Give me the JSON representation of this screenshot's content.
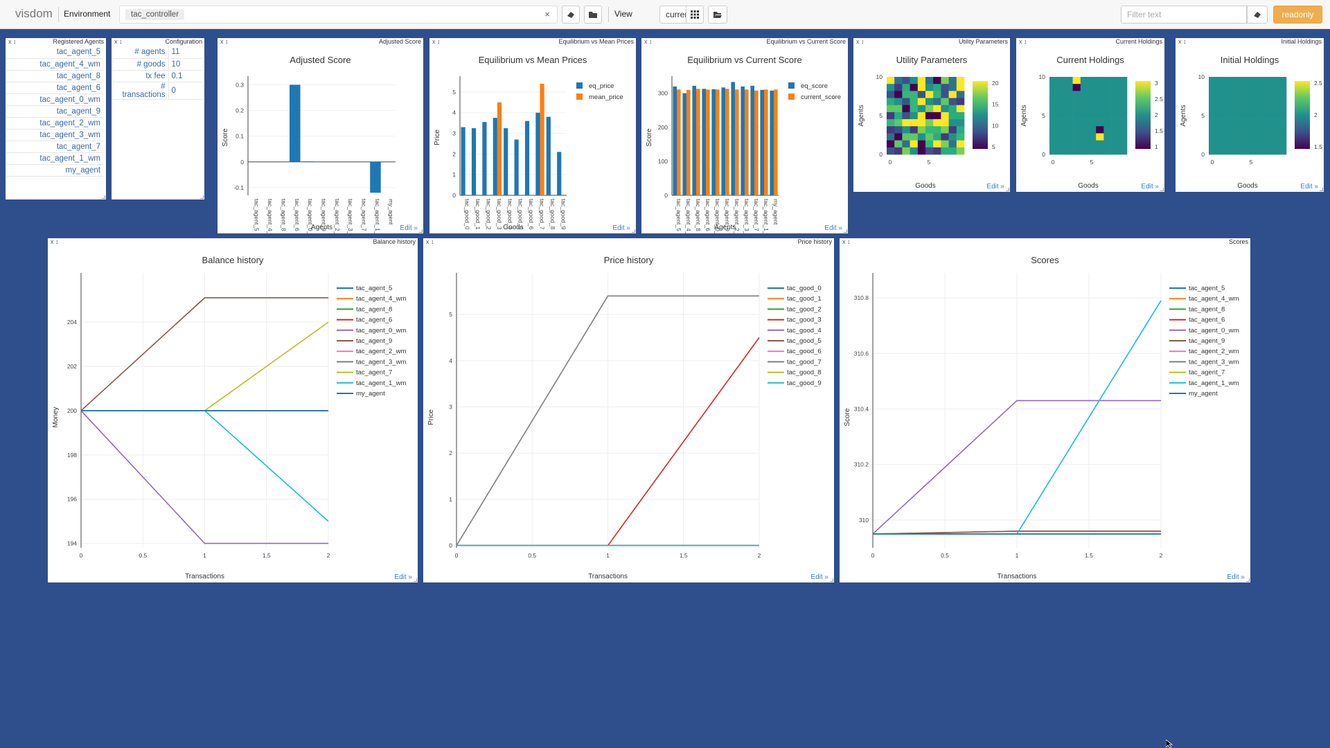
{
  "topbar": {
    "brand": "visdom",
    "env_label": "Environment",
    "env_value": "tac_controller",
    "env_clear": "×",
    "view_label": "View",
    "view_value": "current",
    "filter_placeholder": "Filter text",
    "readonly": "readonly"
  },
  "panes": {
    "agents": {
      "title": "Registered Agents",
      "items": [
        "tac_agent_5",
        "tac_agent_4_wm",
        "tac_agent_8",
        "tac_agent_6",
        "tac_agent_0_wm",
        "tac_agent_9",
        "tac_agent_2_wm",
        "tac_agent_3_wm",
        "tac_agent_7",
        "tac_agent_1_wm",
        "my_agent"
      ]
    },
    "config": {
      "title": "Configuration",
      "rows": [
        {
          "k": "# agents",
          "v": "11"
        },
        {
          "k": "# goods",
          "v": "10"
        },
        {
          "k": "tx fee",
          "v": "0.1"
        },
        {
          "k": "# transactions",
          "v": "0"
        }
      ]
    },
    "edit_label": "Edit »",
    "pane_controls": "x  ↕"
  },
  "chart_data": [
    {
      "id": "adjusted",
      "type": "bar",
      "title": "Adjusted Score",
      "xlabel": "Agents",
      "ylabel": "Score",
      "categories": [
        "tac_agent_5",
        "tac_agent_4_wm",
        "tac_agent_8",
        "tac_agent_6",
        "tac_agent_0_wm",
        "tac_agent_9",
        "tac_agent_2_wm",
        "tac_agent_3_wm",
        "tac_agent_7",
        "tac_agent_1_wm",
        "my_agent"
      ],
      "ticks": [
        0.3,
        0.2,
        0.1,
        0,
        -0.1
      ],
      "ylim": [
        -0.13,
        0.32
      ],
      "values": [
        0,
        0,
        0,
        0.3,
        0.002,
        0,
        0,
        0,
        0,
        -0.12,
        0
      ]
    },
    {
      "id": "eqmean",
      "type": "bar",
      "title": "Equilibrium vs Mean Prices",
      "xlabel": "Goods",
      "ylabel": "Price",
      "categories": [
        "tac_good_0",
        "tac_good_1",
        "tac_good_2",
        "tac_good_3",
        "tac_good_4",
        "tac_good_5",
        "tac_good_6",
        "tac_good_7",
        "tac_good_8",
        "tac_good_9"
      ],
      "ticks": [
        5,
        4,
        3,
        2,
        1,
        0
      ],
      "ylim": [
        0,
        5.6
      ],
      "series": [
        {
          "name": "eq_price",
          "color": "#1f77b4",
          "values": [
            3.3,
            3.25,
            3.55,
            3.75,
            3.25,
            2.7,
            3.6,
            4.0,
            3.8,
            2.1
          ]
        },
        {
          "name": "mean_price",
          "color": "#ff7f0e",
          "values": [
            0,
            0,
            0,
            4.5,
            0,
            0,
            0,
            5.4,
            0,
            0
          ]
        }
      ]
    },
    {
      "id": "eqcur",
      "type": "bar",
      "title": "Equilibrium vs Current Score",
      "xlabel": "Agents",
      "ylabel": "Score",
      "categories": [
        "tac_agent_5",
        "tac_agent_4_wm",
        "tac_agent_8",
        "tac_agent_6",
        "tac_agent_0_wm",
        "tac_agent_9",
        "tac_agent_2_wm",
        "tac_agent_3_wm",
        "tac_agent_7",
        "tac_agent_1_wm",
        "my_agent"
      ],
      "ticks": [
        300,
        200,
        100,
        0
      ],
      "ylim": [
        0,
        340
      ],
      "series": [
        {
          "name": "eq_score",
          "color": "#1f77b4",
          "values": [
            320,
            300,
            322,
            313,
            312,
            317,
            333,
            320,
            322,
            310,
            308
          ]
        },
        {
          "name": "current_score",
          "color": "#ff7f0e",
          "values": [
            311,
            310,
            313,
            311,
            311,
            313,
            311,
            311,
            308,
            311,
            311
          ]
        }
      ]
    },
    {
      "id": "utility",
      "type": "heatmap",
      "title": "Utility Parameters",
      "xlabel": "Goods",
      "ylabel": "Agents",
      "yticks": [
        10,
        5,
        0
      ],
      "xticks": [
        0,
        5
      ],
      "cbticks": [
        20,
        15,
        10,
        5
      ]
    },
    {
      "id": "current",
      "type": "heatmap",
      "title": "Current Holdings",
      "xlabel": "Goods",
      "ylabel": "Agents",
      "yticks": [
        10,
        5,
        0
      ],
      "xticks": [
        0,
        5
      ],
      "cbticks": [
        3,
        2.5,
        2,
        1.5,
        1
      ]
    },
    {
      "id": "initial",
      "type": "heatmap",
      "title": "Initial Holdings",
      "xlabel": "Goods",
      "ylabel": "Agents",
      "yticks": [
        10,
        5,
        0
      ],
      "xticks": [
        0,
        5
      ],
      "cbticks": [
        2.5,
        2,
        1.5
      ]
    },
    {
      "id": "balance",
      "type": "line",
      "title": "Balance history",
      "xlabel": "Transactions",
      "ylabel": "Money",
      "x": [
        0,
        1,
        2
      ],
      "xticks": [
        0,
        0.5,
        1,
        1.5,
        2
      ],
      "yticks": [
        204,
        202,
        200,
        198,
        196,
        194
      ],
      "ylim": [
        193.8,
        205.6
      ],
      "series": [
        {
          "name": "tac_agent_5",
          "color": "#1f77b4",
          "values": [
            200,
            200,
            200
          ]
        },
        {
          "name": "tac_agent_4_wm",
          "color": "#ff7f0e",
          "values": [
            200,
            200,
            200
          ]
        },
        {
          "name": "tac_agent_8",
          "color": "#2ca02c",
          "values": [
            200,
            200,
            200
          ]
        },
        {
          "name": "tac_agent_6",
          "color": "#d62728",
          "values": [
            200,
            200,
            200
          ]
        },
        {
          "name": "tac_agent_0_wm",
          "color": "#9467bd",
          "values": [
            200,
            194,
            194
          ]
        },
        {
          "name": "tac_agent_9",
          "color": "#8c564b",
          "values": [
            200,
            205.1,
            205.1
          ]
        },
        {
          "name": "tac_agent_2_wm",
          "color": "#e377c2",
          "values": [
            200,
            200,
            200
          ]
        },
        {
          "name": "tac_agent_3_wm",
          "color": "#7f7f7f",
          "values": [
            200,
            200,
            200
          ]
        },
        {
          "name": "tac_agent_7",
          "color": "#bcbd22",
          "values": [
            200,
            200,
            204
          ]
        },
        {
          "name": "tac_agent_1_wm",
          "color": "#17becf",
          "values": [
            200,
            200,
            195
          ]
        },
        {
          "name": "my_agent",
          "color": "#1f77b4",
          "values": [
            200,
            200,
            200
          ]
        }
      ]
    },
    {
      "id": "price",
      "type": "line",
      "title": "Price history",
      "xlabel": "Transactions",
      "ylabel": "Price",
      "x": [
        0,
        1,
        2
      ],
      "xticks": [
        0,
        0.5,
        1,
        1.5,
        2
      ],
      "yticks": [
        5,
        4,
        3,
        2,
        1,
        0
      ],
      "ylim": [
        -0.05,
        5.6
      ],
      "series": [
        {
          "name": "tac_good_0",
          "color": "#1f77b4",
          "values": [
            0,
            0,
            0
          ]
        },
        {
          "name": "tac_good_1",
          "color": "#ff7f0e",
          "values": [
            0,
            0,
            0
          ]
        },
        {
          "name": "tac_good_2",
          "color": "#2ca02c",
          "values": [
            0,
            0,
            0
          ]
        },
        {
          "name": "tac_good_3",
          "color": "#d62728",
          "values": [
            0,
            0,
            4.5
          ]
        },
        {
          "name": "tac_good_4",
          "color": "#9467bd",
          "values": [
            0,
            0,
            0
          ]
        },
        {
          "name": "tac_good_5",
          "color": "#8c564b",
          "values": [
            0,
            0,
            0
          ]
        },
        {
          "name": "tac_good_6",
          "color": "#e377c2",
          "values": [
            0,
            0,
            0
          ]
        },
        {
          "name": "tac_good_7",
          "color": "#7f7f7f",
          "values": [
            0,
            5.4,
            5.4
          ]
        },
        {
          "name": "tac_good_8",
          "color": "#bcbd22",
          "values": [
            0,
            0,
            0
          ]
        },
        {
          "name": "tac_good_9",
          "color": "#17becf",
          "values": [
            0,
            0,
            0
          ]
        }
      ]
    },
    {
      "id": "scores",
      "type": "line",
      "title": "Scores",
      "xlabel": "Transactions",
      "ylabel": "Score",
      "x": [
        0,
        1,
        2
      ],
      "xticks": [
        0,
        0.5,
        1,
        1.5,
        2
      ],
      "yticks": [
        310.8,
        310.6,
        310.4,
        310.2,
        310
      ],
      "ylim": [
        309.9,
        310.84
      ],
      "series": [
        {
          "name": "tac_agent_5",
          "color": "#1f77b4",
          "values": [
            309.95,
            309.95,
            309.95
          ]
        },
        {
          "name": "tac_agent_4_wm",
          "color": "#ff7f0e",
          "values": [
            309.95,
            309.96,
            309.96
          ]
        },
        {
          "name": "tac_agent_8",
          "color": "#2ca02c",
          "values": [
            309.95,
            309.95,
            309.95
          ]
        },
        {
          "name": "tac_agent_6",
          "color": "#d62728",
          "values": [
            309.95,
            309.95,
            309.95
          ]
        },
        {
          "name": "tac_agent_0_wm",
          "color": "#9467bd",
          "values": [
            309.95,
            310.43,
            310.43
          ]
        },
        {
          "name": "tac_agent_9",
          "color": "#8c564b",
          "values": [
            309.95,
            309.96,
            309.96
          ]
        },
        {
          "name": "tac_agent_2_wm",
          "color": "#e377c2",
          "values": [
            309.95,
            309.95,
            309.95
          ]
        },
        {
          "name": "tac_agent_3_wm",
          "color": "#7f7f7f",
          "values": [
            309.95,
            309.95,
            309.95
          ]
        },
        {
          "name": "tac_agent_7",
          "color": "#bcbd22",
          "values": [
            309.95,
            309.95,
            309.95
          ]
        },
        {
          "name": "tac_agent_1_wm",
          "color": "#17becf",
          "values": [
            309.95,
            309.95,
            310.79
          ]
        },
        {
          "name": "my_agent",
          "color": "#1f77b4",
          "values": [
            309.95,
            309.95,
            309.95
          ]
        }
      ]
    }
  ]
}
